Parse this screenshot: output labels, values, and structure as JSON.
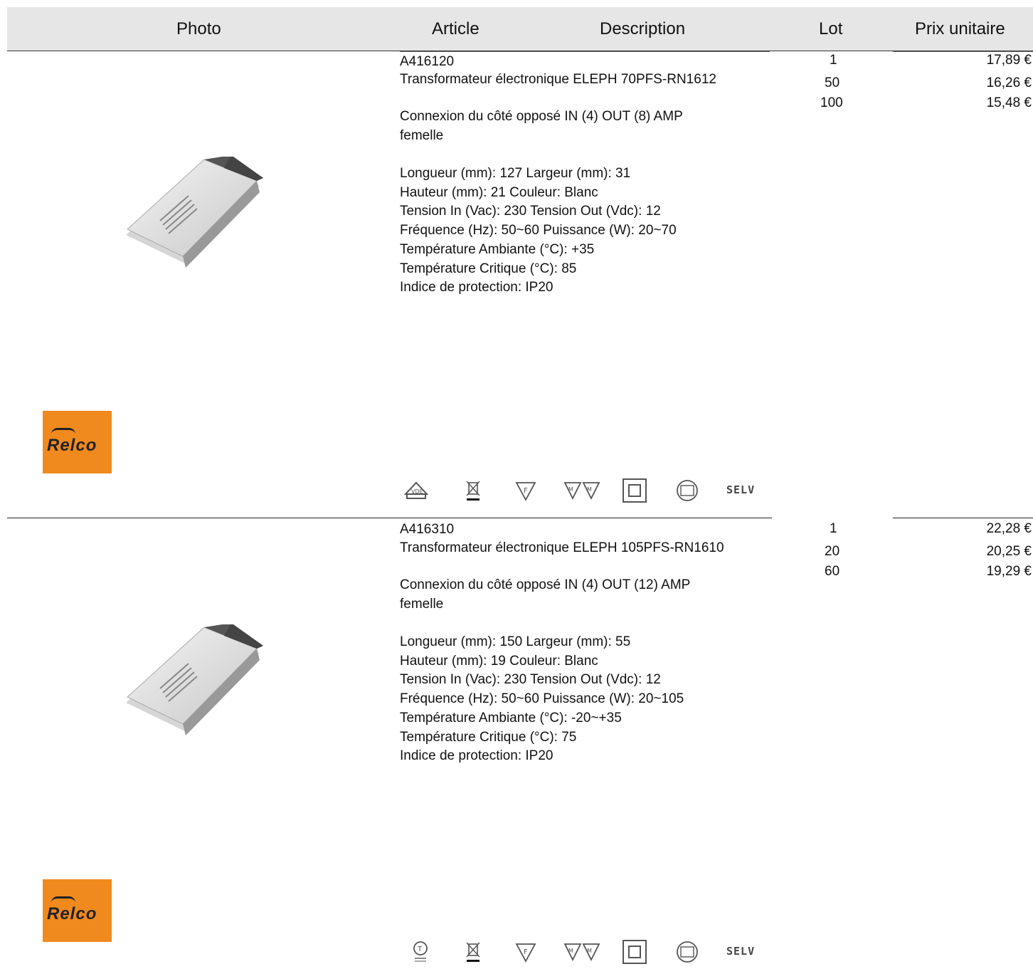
{
  "header": {
    "photo": "Photo",
    "article": "Article",
    "description": "Description",
    "lot": "Lot",
    "price": "Prix unitaire"
  },
  "products": [
    {
      "code": "A416120",
      "name": "Transformateur électronique ELEPH 70PFS-RN1612",
      "connexion": "Connexion du côté opposé IN (4) OUT (8) AMP\nfemelle",
      "specs": "Longueur (mm): 127 Largeur (mm): 31\nHauteur (mm): 21 Couleur: Blanc\nTension In (Vac): 230 Tension Out (Vdc): 12\nFréquence (Hz): 50~60 Puissance (W): 20~70\nTempérature Ambiante (°C): +35\nTempérature Critique (°C): 85\nIndice de protection: IP20",
      "lots": [
        "1",
        "50",
        "100"
      ],
      "prices": [
        "17,89 €",
        "16,26 €",
        "15,48 €"
      ],
      "brand": "Relco",
      "first_icon": "house-icon",
      "selv": "SELV"
    },
    {
      "code": "A416310",
      "name": "Transformateur électronique ELEPH 105PFS-RN1610",
      "connexion": "Connexion du côté opposé IN (4) OUT (12) AMP\nfemelle",
      "specs": "Longueur (mm): 150 Largeur (mm): 55\nHauteur (mm): 19 Couleur: Blanc\nTension In (Vac): 230 Tension Out (Vdc): 12\nFréquence (Hz): 50~60 Puissance (W): 20~105\nTempérature Ambiante (°C): -20~+35\nTempérature Critique (°C): 75\nIndice de protection: IP20",
      "lots": [
        "1",
        "20",
        "60"
      ],
      "prices": [
        "22,28 €",
        "20,25 €",
        "19,29 €"
      ],
      "brand": "Relco",
      "first_icon": "t-mark-icon",
      "selv": "SELV"
    }
  ],
  "colors": {
    "header_bg": "#e6e6e6",
    "logo_orange": "#f08a1e"
  }
}
